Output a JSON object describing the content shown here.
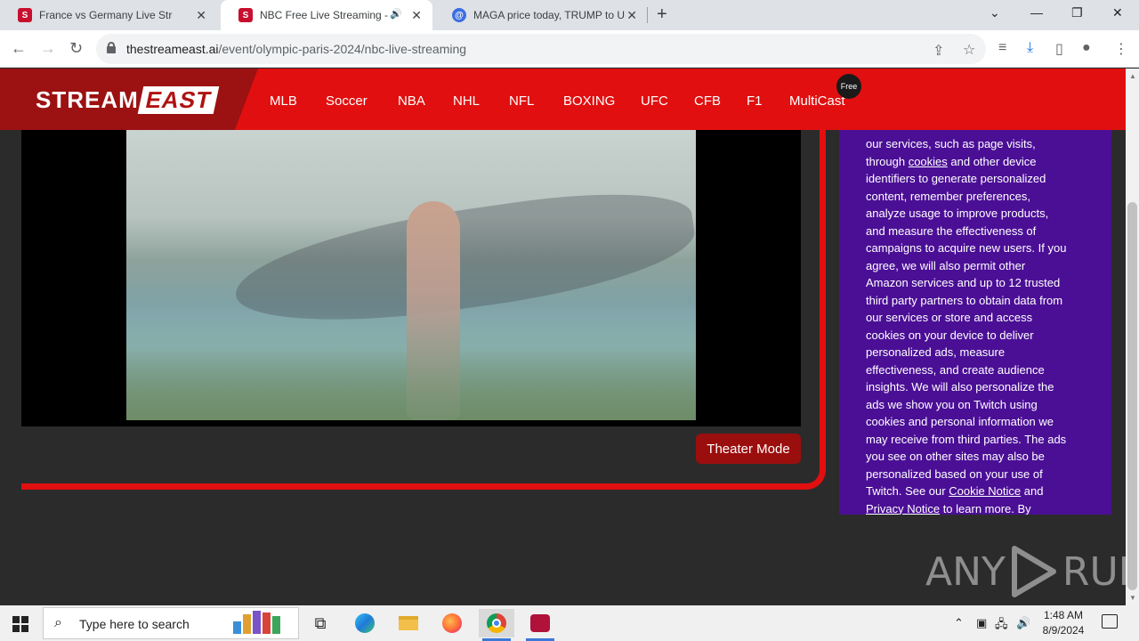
{
  "browser": {
    "tabs": [
      {
        "title": "France vs Germany Live Streamin",
        "favicon": "S"
      },
      {
        "title": "NBC Free Live Streaming - St",
        "favicon": "S"
      },
      {
        "title": "MAGA price today, TRUMP to US",
        "favicon": "@"
      }
    ],
    "url_host": "thestreameast.ai",
    "url_path": "/event/olympic-paris-2024/nbc-live-streaming"
  },
  "site": {
    "logo_left": "STREAM",
    "logo_right": "EAST",
    "nav": [
      "MLB",
      "Soccer",
      "NBA",
      "NHL",
      "NFL",
      "BOXING",
      "UFC",
      "CFB",
      "F1",
      "MultiCast"
    ],
    "free_badge": "Free",
    "theater_button": "Theater Mode"
  },
  "consent": {
    "l1": "our services, such as page visits,",
    "l2a": "through ",
    "l2link": "cookies",
    "l2b": " and other device",
    "l3": "identifiers to generate personalized",
    "l4": "content, remember preferences,",
    "l5": "analyze usage to improve products,",
    "l6": "and measure the effectiveness of",
    "l7": "campaigns to acquire new users. If you",
    "l8": "agree, we will also permit other",
    "l9": "Amazon services and up to 12 trusted",
    "l10": "third party partners to obtain data from",
    "l11": "our services or store and access",
    "l12": "cookies on your device to deliver",
    "l13": "personalized ads, measure",
    "l14": "effectiveness, and create audience",
    "l15": "insights. We will also personalize the",
    "l16": "ads we show you on Twitch using",
    "l17": "cookies and personal information we",
    "l18": "may receive from third parties. The ads",
    "l19": "you see on other sites may also be",
    "l20": "personalized based on your use of",
    "l21a": "Twitch. See our ",
    "l21link": "Cookie Notice",
    "l21b": " and",
    "l22link": "Privacy Notice",
    "l22b": " to learn more. By"
  },
  "watermark": {
    "left": "ANY",
    "right": "RUN"
  },
  "taskbar": {
    "search_placeholder": "Type here to search",
    "time": "1:48 AM",
    "date": "8/9/2024"
  },
  "colors": {
    "brand_red": "#e10f0f",
    "consent_purple": "#4b0f96"
  }
}
